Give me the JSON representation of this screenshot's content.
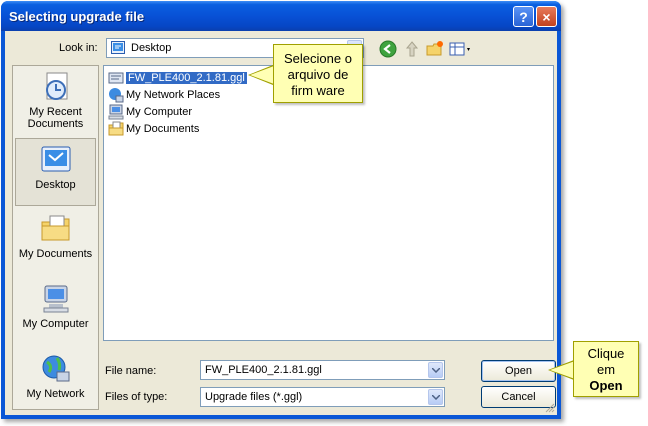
{
  "window": {
    "title": "Selecting upgrade file"
  },
  "titlebar": {
    "help_glyph": "?",
    "close_glyph": "×"
  },
  "lookin": {
    "label": "Look in:",
    "value": "Desktop"
  },
  "toolbar": {
    "icons": [
      "back-icon",
      "up-folder-icon",
      "new-folder-icon",
      "view-menu-icon"
    ]
  },
  "places": [
    {
      "label": "My Recent Documents"
    },
    {
      "label": "Desktop"
    },
    {
      "label": "My Documents"
    },
    {
      "label": "My Computer"
    },
    {
      "label": "My Network"
    }
  ],
  "files": [
    {
      "name": "FW_PLE400_2.1.81.ggl",
      "selected": true
    },
    {
      "name": "My Network Places"
    },
    {
      "name": "My Computer"
    },
    {
      "name": "My Documents"
    }
  ],
  "filename": {
    "label": "File name:",
    "value": "FW_PLE400_2.1.81.ggl"
  },
  "filetype": {
    "label": "Files of type:",
    "value": "Upgrade files (*.ggl)"
  },
  "buttons": {
    "open": "Open",
    "cancel": "Cancel"
  },
  "callouts": {
    "select_line1": "Selecione o",
    "select_line2": "arquivo de",
    "select_line3": "firm ware",
    "open_line1": "Clique",
    "open_line2": "em",
    "open_line3": "Open"
  },
  "colors": {
    "titlebar": "#0a57d6",
    "selection": "#316ac5",
    "callout": "#ffffb4",
    "dialog": "#ece9d8"
  }
}
